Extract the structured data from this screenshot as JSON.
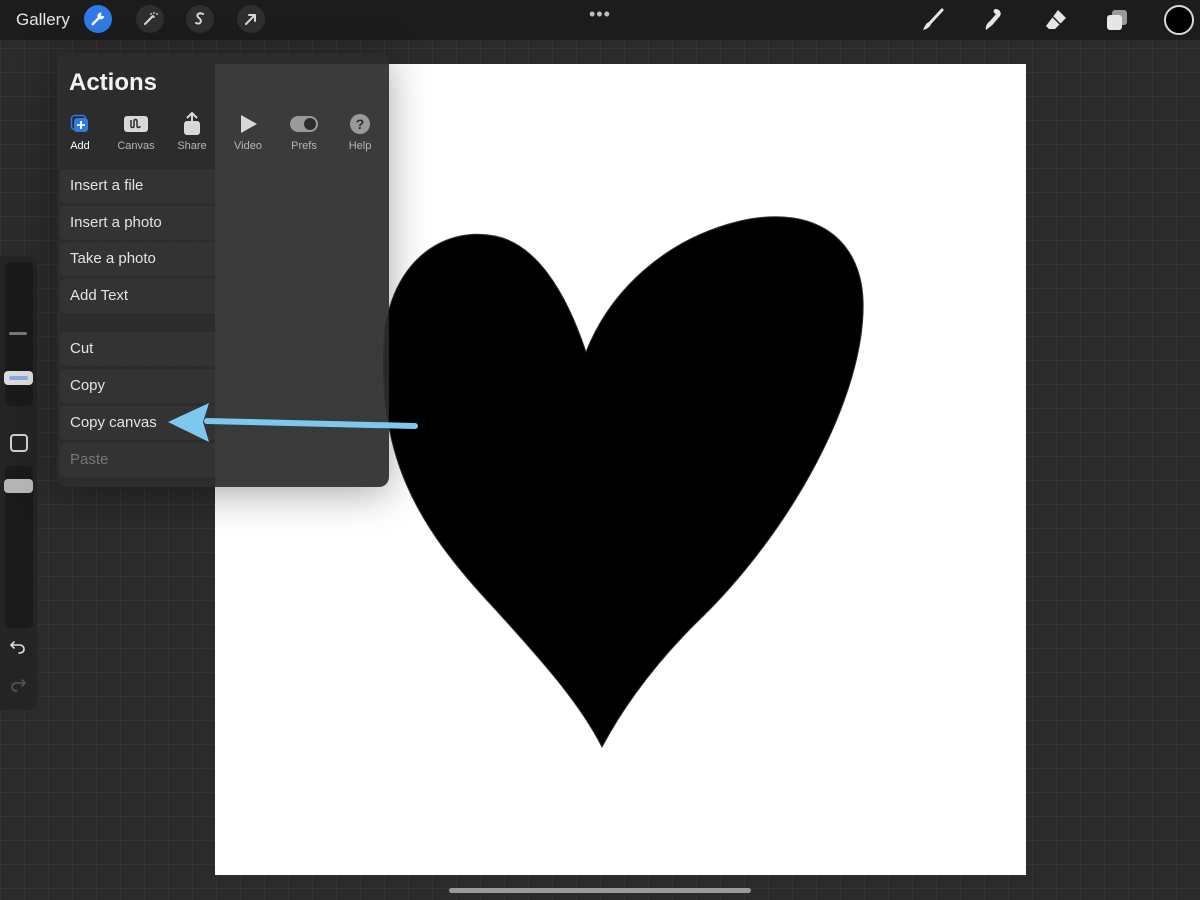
{
  "toolbar": {
    "gallery_label": "Gallery",
    "left_tools": [
      "wrench-icon",
      "magic-wand-icon",
      "selection-s-icon",
      "transform-arrow-icon"
    ],
    "active_tool": "wrench-icon",
    "right_tools": [
      "brush-icon",
      "smudge-icon",
      "eraser-icon",
      "layers-icon"
    ],
    "current_color": "#000000",
    "accent": "#2f7ae5"
  },
  "actions_panel": {
    "title": "Actions",
    "tabs": [
      {
        "label": "Add",
        "icon": "add-icon",
        "active": true
      },
      {
        "label": "Canvas",
        "icon": "canvas-icon",
        "active": false
      },
      {
        "label": "Share",
        "icon": "share-icon",
        "active": false
      },
      {
        "label": "Video",
        "icon": "play-icon",
        "active": false
      },
      {
        "label": "Prefs",
        "icon": "toggle-icon",
        "active": false
      },
      {
        "label": "Help",
        "icon": "help-icon",
        "active": false
      }
    ],
    "group1": [
      "Insert a file",
      "Insert a photo",
      "Take a photo",
      "Add Text"
    ],
    "group2": [
      "Cut",
      "Copy",
      "Copy canvas",
      "Paste"
    ],
    "disabled_items": [
      "Paste"
    ]
  },
  "annotation": {
    "arrow_color": "#7ec8f0",
    "points_to": "Copy canvas"
  },
  "canvas": {
    "background": "#ffffff",
    "shape": "heart",
    "shape_color": "#000000"
  },
  "sidebar": {
    "controls": [
      "brush-size-slider",
      "modify-button",
      "opacity-slider",
      "undo-icon",
      "redo-icon"
    ],
    "slider_accent": "#8fa8e0"
  }
}
